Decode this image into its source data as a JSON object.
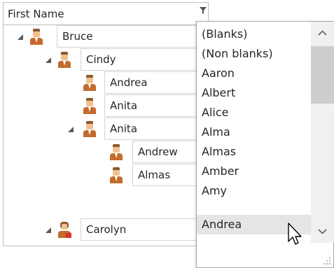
{
  "header": {
    "column_title": "First Name"
  },
  "tree": {
    "rows": [
      {
        "name": "Bruce"
      },
      {
        "name": "Cindy"
      },
      {
        "name": "Andrea"
      },
      {
        "name": "Anita"
      },
      {
        "name": "Anita"
      },
      {
        "name": "Andrew"
      },
      {
        "name": "Almas"
      },
      {
        "name": "Carolyn"
      }
    ]
  },
  "filter_popup": {
    "items": [
      "(Blanks)",
      "(Non blanks)",
      "Aaron",
      "Albert",
      "Alice",
      "Alma",
      "Almas",
      "Amber",
      "Amy",
      "Andrea"
    ],
    "selected": "Andrea"
  },
  "icons": {
    "filter": "filter-icon",
    "expand": "expanded-triangle-icon",
    "person": "person-icon",
    "person_alt": "person-female-icon",
    "scroll_up": "chevron-up-icon",
    "scroll_down": "chevron-down-icon",
    "resize": "resize-grip-icon",
    "cursor": "mouse-pointer-icon"
  },
  "colors": {
    "selected_bg": "#e5e5e5",
    "person_shirt": "#c46a2c",
    "person_skin": "#f2c08f",
    "person_hair": "#8a5a2b",
    "grid": "#d4d4d4"
  }
}
